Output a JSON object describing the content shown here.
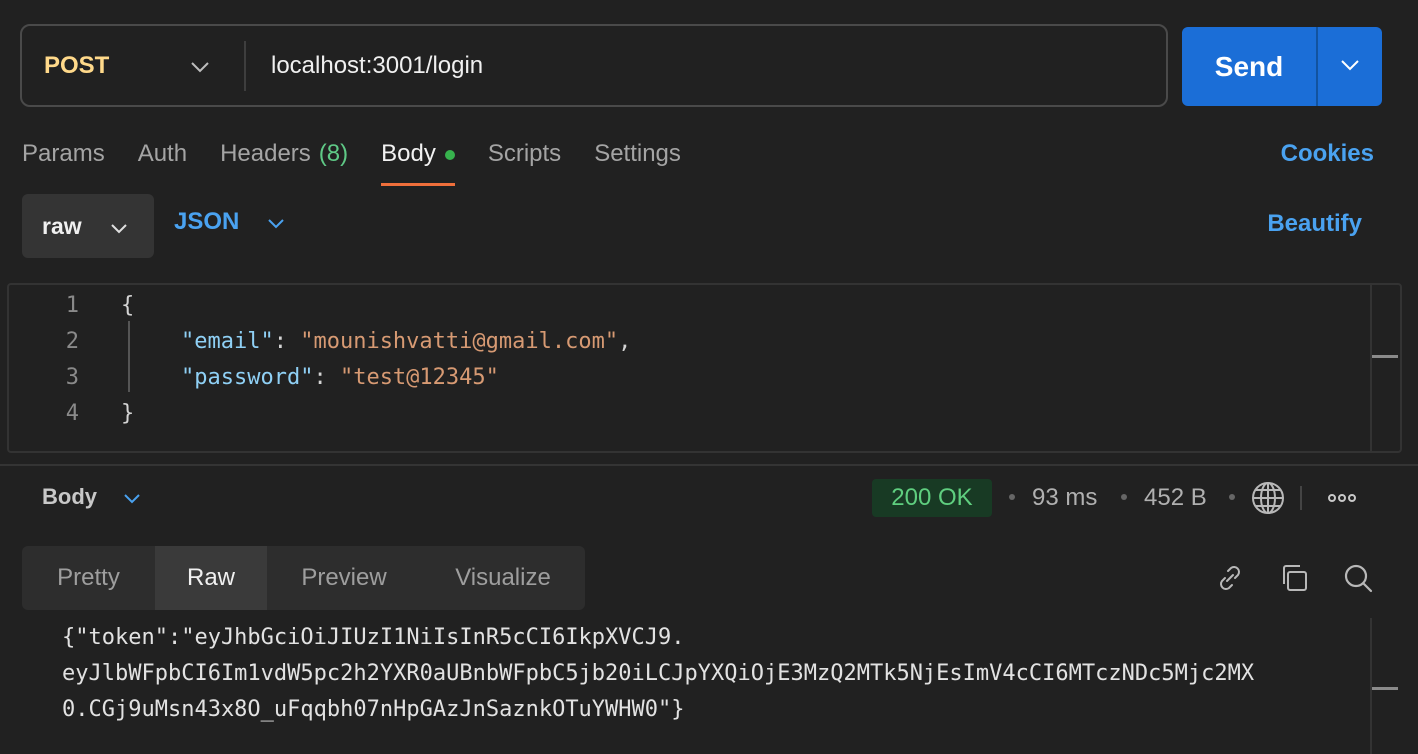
{
  "request": {
    "method": "POST",
    "url": "localhost:3001/login",
    "send_label": "Send"
  },
  "tabs": [
    {
      "label": "Params"
    },
    {
      "label": "Auth"
    },
    {
      "label": "Headers",
      "count": "(8)"
    },
    {
      "label": "Body",
      "active": true
    },
    {
      "label": "Scripts"
    },
    {
      "label": "Settings"
    }
  ],
  "cookies_label": "Cookies",
  "body_toolbar": {
    "mode": "raw",
    "format": "JSON",
    "beautify_label": "Beautify"
  },
  "editor": {
    "lines": [
      {
        "n": "1",
        "open": "{"
      },
      {
        "n": "2",
        "key": "\"email\"",
        "sep": ": ",
        "value": "\"mounishvatti@gmail.com\"",
        "tail": ","
      },
      {
        "n": "3",
        "key": "\"password\"",
        "sep": ": ",
        "value": "\"test@12345\"",
        "tail": ""
      },
      {
        "n": "4",
        "close": "}"
      }
    ]
  },
  "response": {
    "section_label": "Body",
    "status": "200 OK",
    "time": "93 ms",
    "size": "452 B",
    "view_tabs": [
      {
        "label": "Pretty"
      },
      {
        "label": "Raw",
        "active": true
      },
      {
        "label": "Preview"
      },
      {
        "label": "Visualize"
      }
    ],
    "lines": [
      "{\"token\":\"eyJhbGciOiJIUzI1NiIsInR5cCI6IkpXVCJ9.",
      "eyJlbWFpbCI6Im1vdW5pc2h2YXR0aUBnbWFpbC5jb20iLCJpYXQiOjE3MzQ2MTk5NjEsImV4cCI6MTczNDc5Mjc2MX",
      "0.CGj9uMsn43x8O_uFqqbh07nHpGAzJnSaznkOTuYWHW0\"}"
    ]
  },
  "colors": {
    "accent_blue": "#1b6ed7",
    "link_blue": "#4aa2f0",
    "method_yellow": "#ffd98a",
    "active_tab_underline": "#ef6f3b",
    "status_green": "#5fce7f"
  }
}
